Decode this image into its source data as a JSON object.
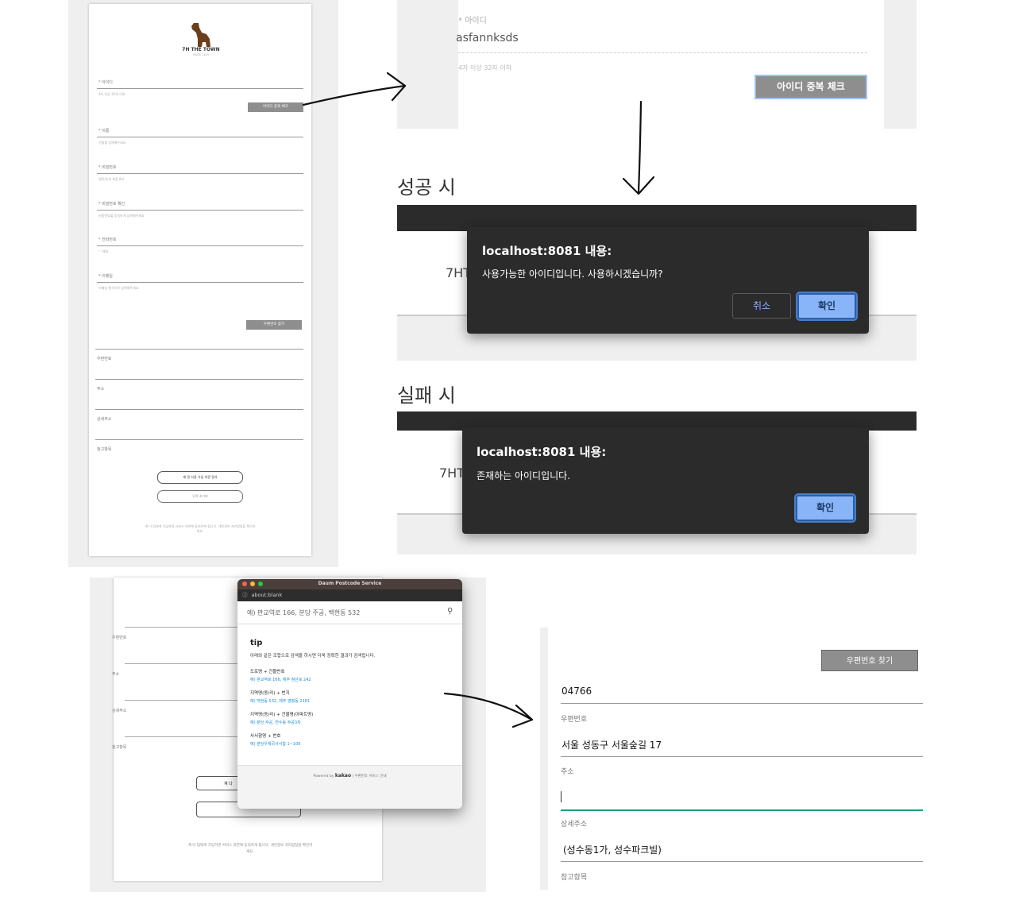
{
  "signup_form": {
    "logo_text": "7H THE TOWN",
    "logo_sub": "SINCE 2020",
    "fields": [
      {
        "label": "* 아이디",
        "hint": "4자 이상 32자 이하"
      },
      {
        "label": "* 이름",
        "hint": "이름을 입력해주세요"
      },
      {
        "label": "* 비밀번호",
        "hint": "영문/숫자 포함 8자"
      },
      {
        "label": "* 비밀번호 확인",
        "hint": "비밀번호를 동일하게 입력해주세요"
      },
      {
        "label": "* 전화번호",
        "hint": "'-' 제외"
      },
      {
        "label": "* 이메일",
        "hint": "이메일 형식으로 입력해주세요"
      }
    ],
    "id_check_button": "아이디 중복 체크",
    "postcode_button": "우편번호 찾기",
    "address_labels": [
      "우편번호",
      "주소",
      "상세주소",
      "참고항목"
    ],
    "submit_button": "계 정 사용 가입 약관 동의",
    "cancel_button": "입력 초기화",
    "footer": "계 다 팀에게 가입하면 서비스 약관에 동의하게 됩니다. 개인정보 처리방침을 확인하세요."
  },
  "id_zoom": {
    "label": "* 아이디",
    "value": "asfannksds",
    "hint": "4자 이상 32자 이하",
    "check_button": "아이디 중복 체크"
  },
  "success": {
    "heading": "성공 시",
    "bg_text": "7HT",
    "dialog_title": "localhost:8081 내용:",
    "dialog_message": "사용가능한 아이디입니다. 사용하시겠습니까?",
    "cancel_label": "취소",
    "ok_label": "확인"
  },
  "failure": {
    "heading": "실패 시",
    "bg_text": "7HT",
    "dialog_title": "localhost:8081 내용:",
    "dialog_message": "존재하는 아이디입니다.",
    "ok_label": "확인"
  },
  "postcode_popup": {
    "window_title": "Daum Postcode Service",
    "address_bar": "about:blank",
    "search_placeholder": "예) 판교역로 166, 분당 주공, 백현동 532",
    "tip_title": "tip",
    "tip_desc": "아래와 같은 조합으로 검색을 하시면 더욱 정확한 결과가 검색됩니다.",
    "tips": [
      {
        "title": "도로명 + 건물번호",
        "example": "예) 판교역로 166, 제주 첨단로 242"
      },
      {
        "title": "지역명(동/리) + 번지",
        "example": "예) 백현동 532, 제주 영평동 2181"
      },
      {
        "title": "지역명(동/리) + 건물명(아파트명)",
        "example": "예) 분당 주공, 연수동 주공3차"
      },
      {
        "title": "사서함명 + 번호",
        "example": "예) 분당우체국사서함 1~100"
      }
    ],
    "powered_by": "Powered by",
    "kakao": "kakao",
    "service_note": "우편번호 서비스 안내",
    "bg_labels": [
      "우편번호",
      "주소",
      "상세주소",
      "참고항목"
    ],
    "bg_button": "계 다",
    "bg_footer": "계 다 팀에게 가입하면 서비스 약관에 동의하게 됩니다. 개인정보 처리방침을 확인하세요."
  },
  "address_result": {
    "find_button": "우편번호 찾기",
    "postcode_value": "04766",
    "postcode_label": "우편번호",
    "address_value": "서울 성동구 서울숲길 17",
    "address_label": "주소",
    "detail_value": "",
    "detail_label": "상세주소",
    "extra_value": "(성수동1가, 성수파크빌)",
    "extra_label": "참고항목"
  }
}
